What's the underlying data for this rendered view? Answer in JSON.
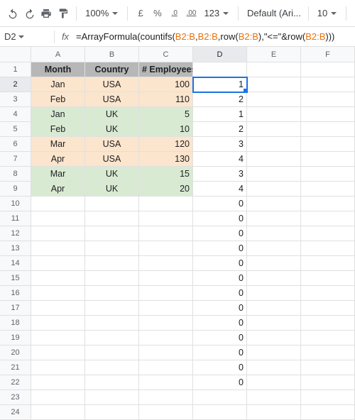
{
  "toolbar": {
    "zoom": "100%",
    "currency": "£",
    "percent": "%",
    "dec_dec": ".0",
    "inc_dec": ".00",
    "more_fmt": "123",
    "font": "Default (Ari...",
    "font_size": "10"
  },
  "namebox": {
    "ref": "D2"
  },
  "formula": {
    "p1": "=ArrayFormula(countifs(",
    "r1": "B2:B",
    "p2": ",",
    "r2": "B2:B",
    "p3": ",row(",
    "r3": "B2:B",
    "p4": "),\"<=\"&row(",
    "r4": "B2:B",
    "p5": ")))"
  },
  "columns": [
    "A",
    "B",
    "C",
    "D",
    "E",
    "F"
  ],
  "headers": {
    "A": "Month",
    "B": "Country",
    "C": "# Employees"
  },
  "rows": [
    {
      "A": "Jan",
      "B": "USA",
      "C": "100",
      "D": "1",
      "cls": "orange",
      "sel": true
    },
    {
      "A": "Feb",
      "B": "USA",
      "C": "110",
      "D": "2",
      "cls": "orange"
    },
    {
      "A": "Jan",
      "B": "UK",
      "C": "5",
      "D": "1",
      "cls": "green"
    },
    {
      "A": "Feb",
      "B": "UK",
      "C": "10",
      "D": "2",
      "cls": "green"
    },
    {
      "A": "Mar",
      "B": "USA",
      "C": "120",
      "D": "3",
      "cls": "orange"
    },
    {
      "A": "Apr",
      "B": "USA",
      "C": "130",
      "D": "4",
      "cls": "orange"
    },
    {
      "A": "Mar",
      "B": "UK",
      "C": "15",
      "D": "3",
      "cls": "green"
    },
    {
      "A": "Apr",
      "B": "UK",
      "C": "20",
      "D": "4",
      "cls": "green"
    },
    {
      "D": "0"
    },
    {
      "D": "0"
    },
    {
      "D": "0"
    },
    {
      "D": "0"
    },
    {
      "D": "0"
    },
    {
      "D": "0"
    },
    {
      "D": "0"
    },
    {
      "D": "0"
    },
    {
      "D": "0"
    },
    {
      "D": "0"
    },
    {
      "D": "0"
    },
    {
      "D": "0"
    },
    {
      "D": "0"
    },
    {},
    {}
  ]
}
